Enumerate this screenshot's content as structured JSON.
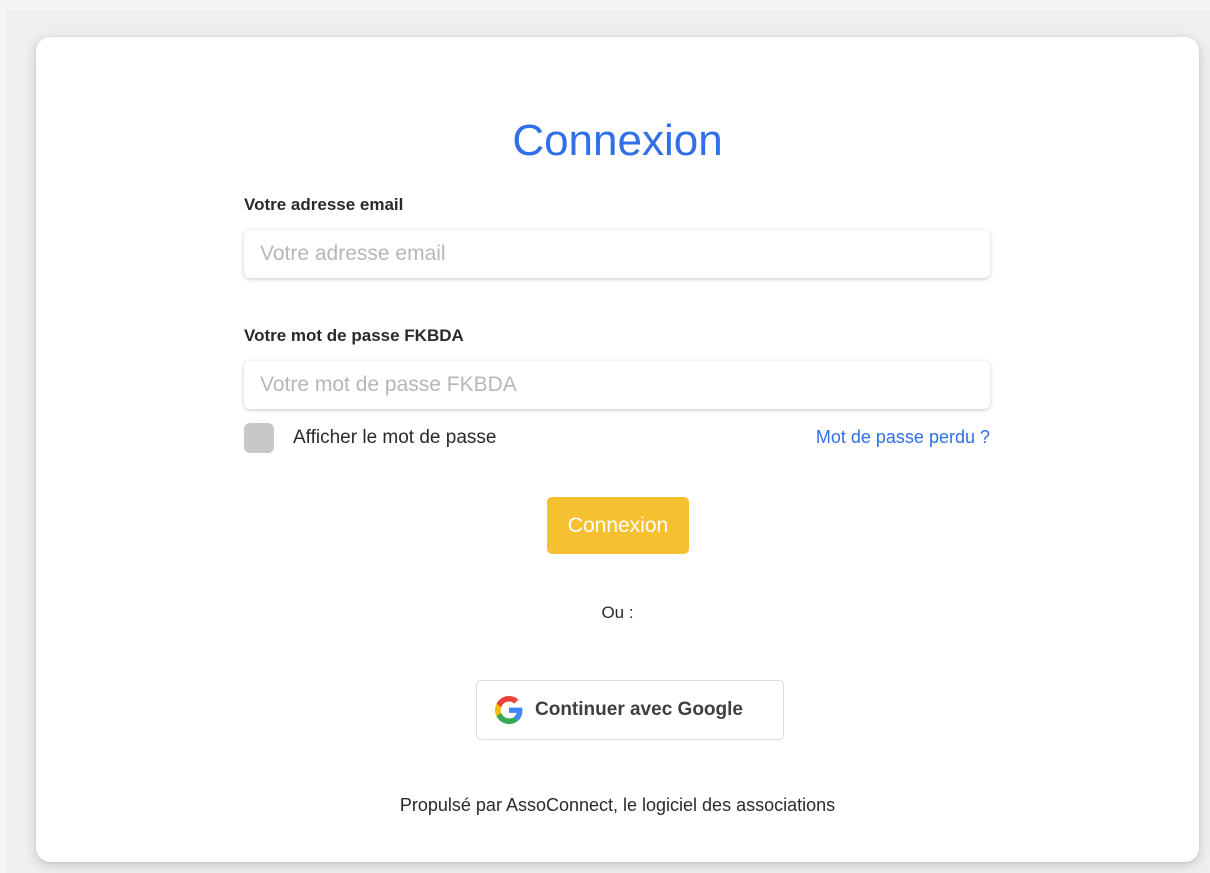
{
  "title": "Connexion",
  "email": {
    "label": "Votre adresse email",
    "placeholder": "Votre adresse email",
    "value": ""
  },
  "password": {
    "label": "Votre mot de passe FKBDA",
    "placeholder": "Votre mot de passe FKBDA",
    "value": ""
  },
  "show_password": {
    "label": "Afficher le mot de passe",
    "checked": false
  },
  "lost_password_link": "Mot de passe perdu ?",
  "submit_label": "Connexion",
  "separator": "Ou :",
  "google": {
    "label": "Continuer avec Google",
    "icon": "google-icon"
  },
  "footer": "Propulsé par AssoConnect, le logiciel des associations",
  "colors": {
    "accent": "#2f6fe8",
    "submit": "#f5c131",
    "checkbox": "#c8c8c8"
  }
}
